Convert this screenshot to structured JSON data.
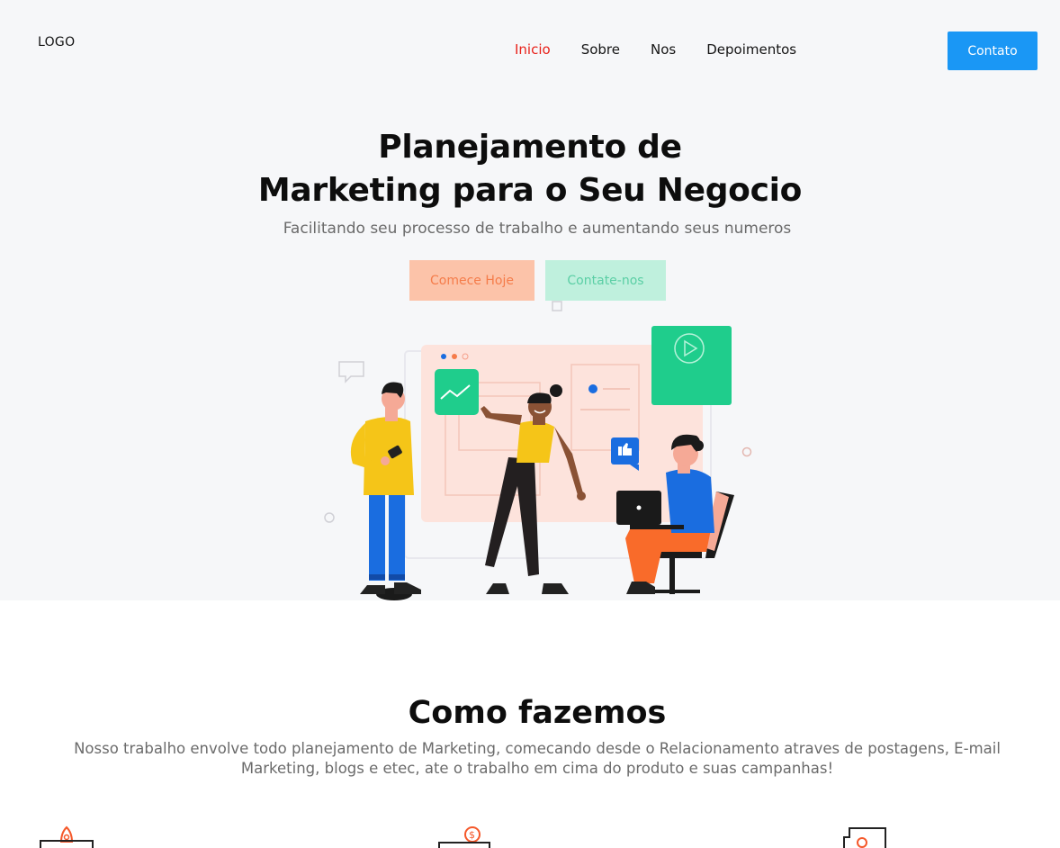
{
  "header": {
    "logo": "LOGO",
    "nav": [
      {
        "label": "Inicio",
        "active": true
      },
      {
        "label": "Sobre",
        "active": false
      },
      {
        "label": "Nos",
        "active": false
      },
      {
        "label": "Depoimentos",
        "active": false
      }
    ],
    "contact_label": "Contato"
  },
  "hero": {
    "title_line1": "Planejamento de",
    "title_line2": "Marketing para o Seu Negocio",
    "subtitle": "Facilitando seu processo de trabalho e aumentando seus numeros",
    "primary_button": "Comece Hoje",
    "secondary_button": "Contate-nos"
  },
  "section": {
    "title": "Como fazemos",
    "description": "Nosso trabalho envolve todo planejamento de Marketing, comecando desde o Relacionamento atraves de postagens, E-mail Marketing, blogs e etec, ate o trabalho em cima do produto e suas campanhas!"
  },
  "features": [
    {
      "icon": "rocket-icon"
    },
    {
      "icon": "money-icon"
    },
    {
      "icon": "target-icon"
    }
  ],
  "colors": {
    "accent_blue": "#1a97f5",
    "active_nav": "#e8221b",
    "primary_btn_bg": "#fcc3a9",
    "secondary_btn_bg": "#bff0dd",
    "hero_bg": "#f6f7f9"
  }
}
